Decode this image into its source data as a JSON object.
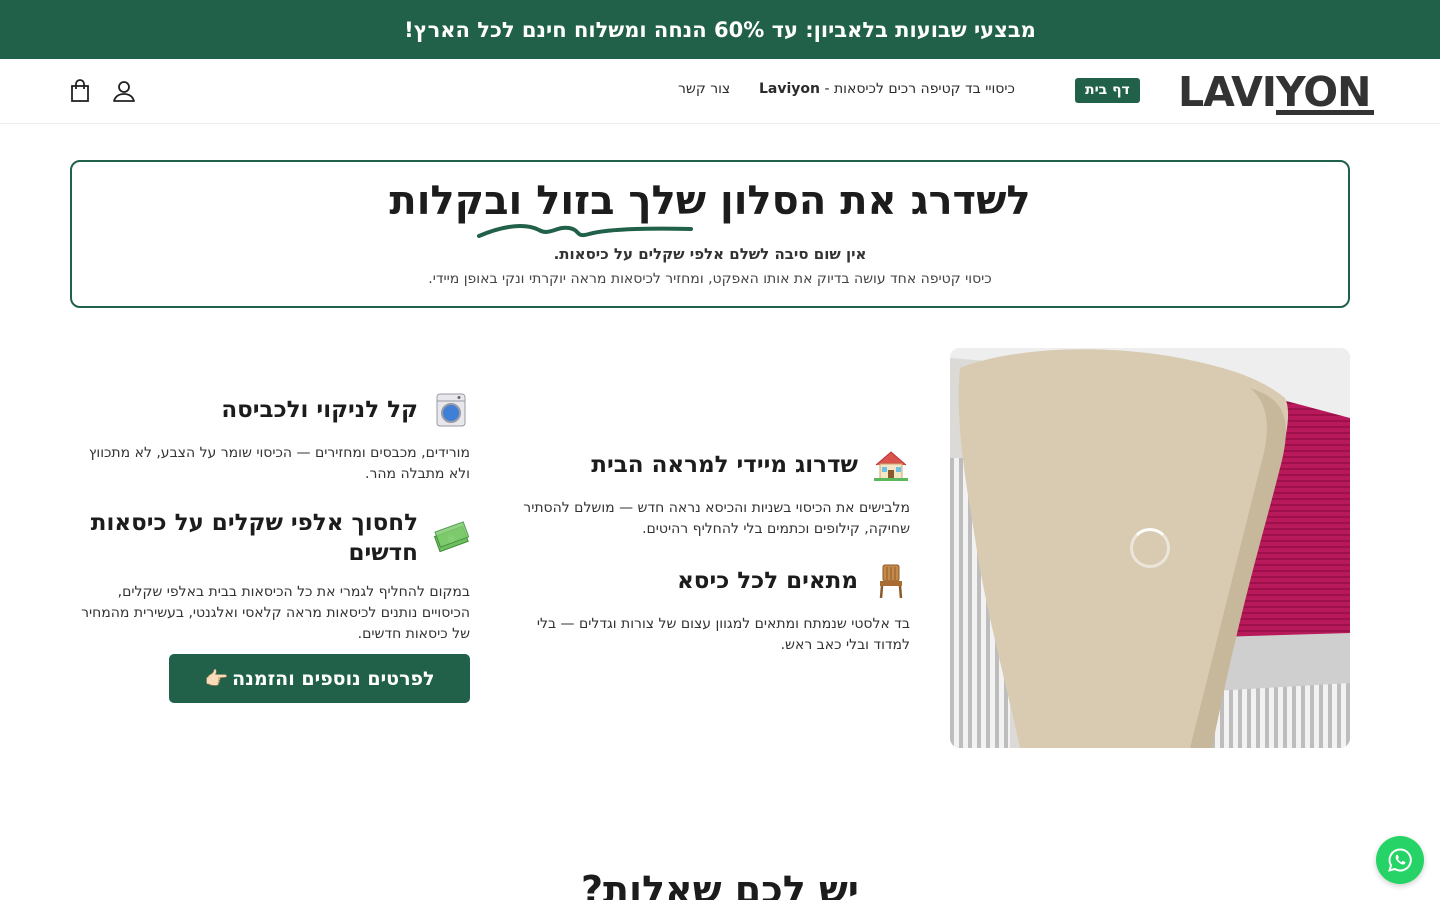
{
  "announcement": {
    "text": "מבצעי שבועות בלאביון: עד 60% הנחה ומשלוח חינם לכל הארץ!"
  },
  "header": {
    "logo": "LAVIYON",
    "nav": {
      "home": "דף בית",
      "product_prefix": "כיסויי בד קטיפה רכים לכיסאות - ",
      "product_brand": "Laviyon",
      "contact": "צור קשר"
    },
    "icons": [
      "account-icon",
      "cart-icon"
    ]
  },
  "hero": {
    "title_main": "לשדרג את הסלון שלך ",
    "title_highlight": "בזול ובקלות",
    "subtitle": "אין שום סיבה לשלם אלפי שקלים על כיסאות.",
    "description": "כיסוי קטיפה אחד עושה בדיוק את אותו האפקט, ומחזיר לכיסאות מראה יוקרתי ונקי באופן מיידי."
  },
  "features": {
    "upgrade": {
      "icon": "house-icon",
      "title": "שדרוג מיידי למראה הבית",
      "text": "מלבישים את הכיסוי בשניות והכיסא נראה חדש — מושלם להסתיר שחיקה, קילופים וכתמים בלי להחליף רהיטים."
    },
    "fits": {
      "icon": "chair-icon",
      "title": "מתאים לכל כיסא",
      "text": "בד אלסטי שנמתח ומתאים למגוון עצום של צורות וגדלים — בלי למדוד ובלי כאב ראש."
    },
    "cleaning": {
      "icon": "washing-machine-icon",
      "title": "קל לניקוי ולכביסה",
      "text": "מורידים, מכבסים ומחזירים — הכיסוי שומר על הצבע, לא מתכווץ ולא מתבלה מהר."
    },
    "save": {
      "icon": "money-icon",
      "title": "לחסוך אלפי שקלים על כיסאות חדשים",
      "text": "במקום להחליף לגמרי את כל הכיסאות בבית באלפי שקלים, הכיסויים נותנים לכיסאות מראה קלאסי ואלגנטי, בעשירית מהמחיר של כיסאות חדשים."
    }
  },
  "cta": {
    "label": "לפרטים נוספים והזמנה",
    "emoji": "👉🏻"
  },
  "faq": {
    "title": "יש לכם שאלות?"
  },
  "colors": {
    "brand_green": "#226149",
    "whatsapp_green": "#25d366"
  }
}
